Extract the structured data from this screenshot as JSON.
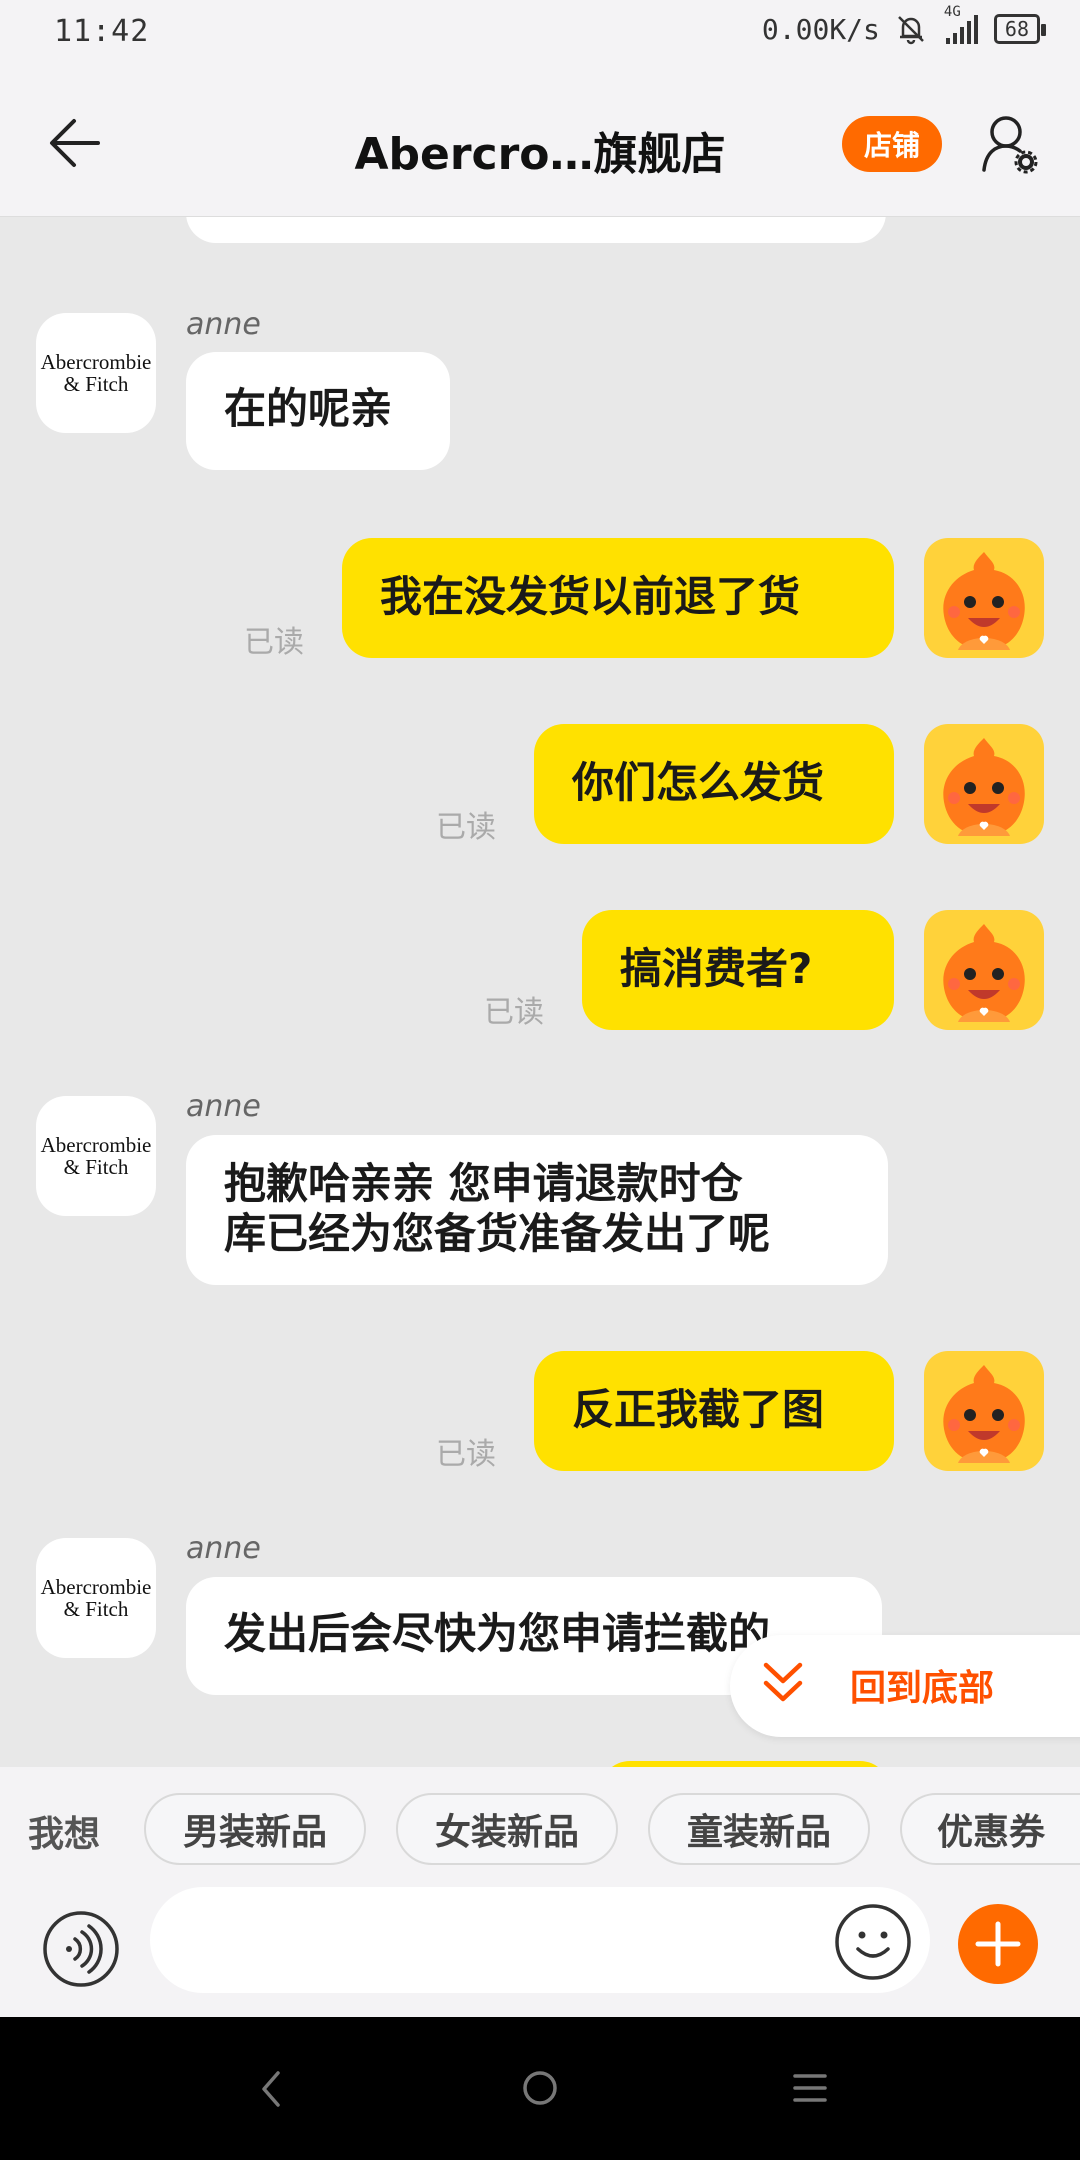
{
  "status_bar": {
    "time": "11:42",
    "network_speed": "0.00K/s",
    "signal_label": "4G",
    "battery": "68"
  },
  "header": {
    "title": "Abercro…旗舰店",
    "shop_button": "店铺"
  },
  "shop_avatar": {
    "line1": "Abercrombie",
    "line2": "& Fitch"
  },
  "messages": [
    {
      "sender": "anne",
      "text": "在的呢亲"
    },
    {
      "text": "我在没发货以前退了货",
      "read": "已读"
    },
    {
      "text": "你们怎么发货",
      "read": "已读"
    },
    {
      "text": "搞消费者?",
      "read": "已读"
    },
    {
      "sender": "anne",
      "text_line1": "抱歉哈亲亲 您申请退款时仓",
      "text_line2": "库已经为您备货准备发出了呢"
    },
    {
      "text": "反正我截了图",
      "read": "已读"
    },
    {
      "sender": "anne",
      "text": "发出后会尽快为您申请拦截的"
    }
  ],
  "scroll_to_bottom": "回到底部",
  "quick_bar": {
    "label": "我想",
    "chips": [
      "男装新品",
      "女装新品",
      "童装新品",
      "优惠券"
    ]
  },
  "colors": {
    "accent": "#ff6a00",
    "outgoing_bubble": "#ffe100",
    "incoming_bubble": "#ffffff",
    "background": "#e8e8e8"
  }
}
